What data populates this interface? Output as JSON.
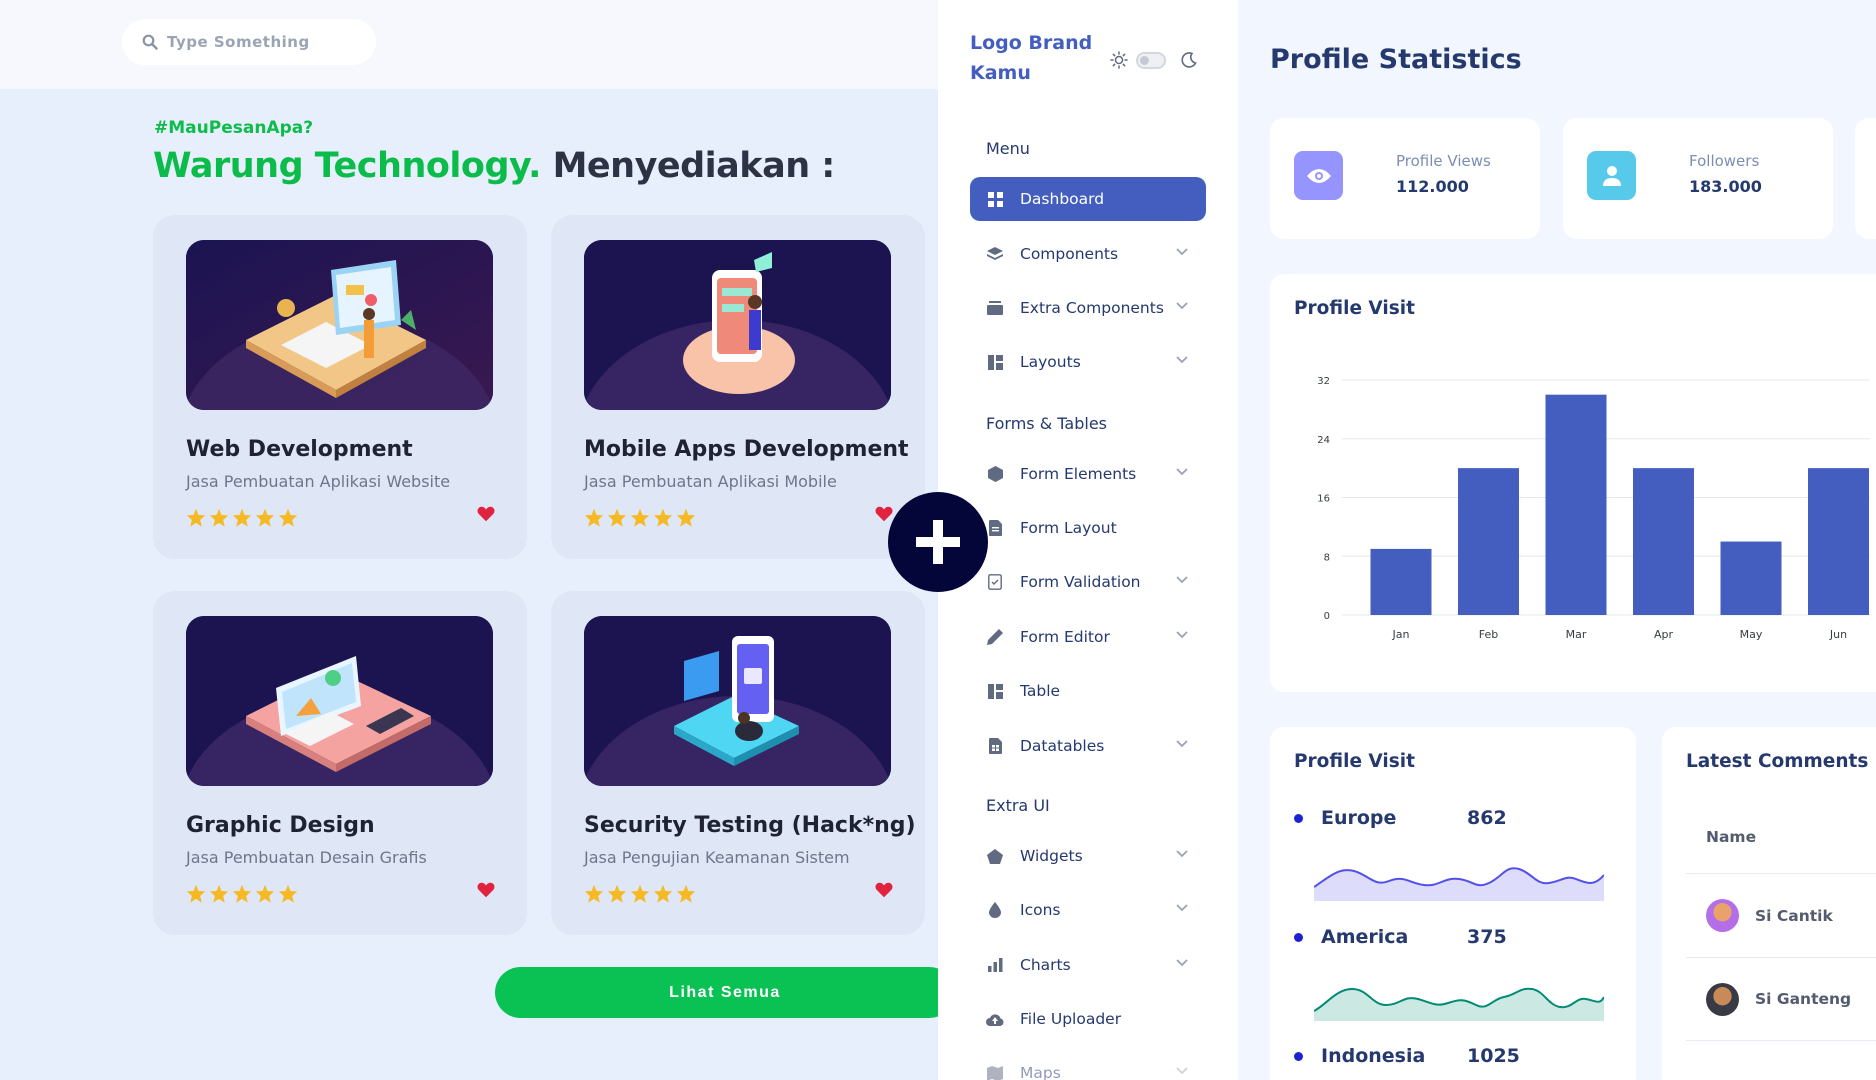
{
  "search": {
    "placeholder": "Type Something"
  },
  "hero": {
    "hashtag": "#MauPesanApa?",
    "brand_green": "Warung Technology.",
    "brand_rest": "Menyediakan :"
  },
  "services": [
    {
      "title": "Web Development",
      "subtitle": "Jasa Pembuatan Aplikasi Website",
      "rating": 5
    },
    {
      "title": "Mobile Apps Development",
      "subtitle": "Jasa Pembuatan Aplikasi Mobile",
      "rating": 5
    },
    {
      "title": "Graphic Design",
      "subtitle": "Jasa Pembuatan Desain Grafis",
      "rating": 5
    },
    {
      "title": "Security Testing (Hack*ng)",
      "subtitle": "Jasa Pengujian Keamanan Sistem",
      "rating": 5
    }
  ],
  "see_all_label": "Lihat Semua",
  "sidebar": {
    "brand": "Logo Brand Kamu",
    "sections": {
      "menu": "Menu",
      "forms": "Forms & Tables",
      "extra": "Extra UI"
    },
    "items": [
      {
        "label": "Dashboard",
        "icon": "grid-icon",
        "active": true
      },
      {
        "label": "Components",
        "icon": "stack-icon"
      },
      {
        "label": "Extra Components",
        "icon": "collection-icon"
      },
      {
        "label": "Layouts",
        "icon": "layout-icon"
      },
      {
        "label": "Form Elements",
        "icon": "hexagon-icon"
      },
      {
        "label": "Form Layout",
        "icon": "file-text-icon"
      },
      {
        "label": "Form Validation",
        "icon": "journal-check-icon"
      },
      {
        "label": "Form Editor",
        "icon": "pen-icon"
      },
      {
        "label": "Table",
        "icon": "table-icon"
      },
      {
        "label": "Datatables",
        "icon": "file-spreadsheet-icon"
      },
      {
        "label": "Widgets",
        "icon": "pentagon-icon"
      },
      {
        "label": "Icons",
        "icon": "droplet-icon"
      },
      {
        "label": "Charts",
        "icon": "bar-chart-icon"
      },
      {
        "label": "File Uploader",
        "icon": "cloud-upload-icon"
      },
      {
        "label": "Maps",
        "icon": "map-icon"
      }
    ]
  },
  "dashboard": {
    "title": "Profile Statistics",
    "stats": [
      {
        "label": "Profile Views",
        "value": "112.000",
        "color": "#9694ff",
        "icon": "eye-icon"
      },
      {
        "label": "Followers",
        "value": "183.000",
        "color": "#57caeb",
        "icon": "user-icon"
      }
    ],
    "chart_title": "Profile Visit",
    "region_title": "Profile Visit",
    "regions": [
      {
        "name": "Europe",
        "value": "862",
        "color": "#5350e9"
      },
      {
        "name": "America",
        "value": "375",
        "color": "#008b75"
      },
      {
        "name": "Indonesia",
        "value": "1025",
        "color": "#ffc434"
      }
    ],
    "comments_title": "Latest Comments",
    "comments_header": "Name",
    "comments": [
      {
        "name": "Si Cantik"
      },
      {
        "name": "Si Ganteng"
      }
    ]
  },
  "chart_data": {
    "type": "bar",
    "categories": [
      "Jan",
      "Feb",
      "Mar",
      "Apr",
      "May",
      "Jun"
    ],
    "values": [
      9,
      20,
      30,
      20,
      10,
      20
    ],
    "ylim": [
      0,
      32
    ],
    "yticks": [
      0,
      8,
      16,
      24,
      32
    ],
    "color": "#435ebe",
    "grid": true
  }
}
